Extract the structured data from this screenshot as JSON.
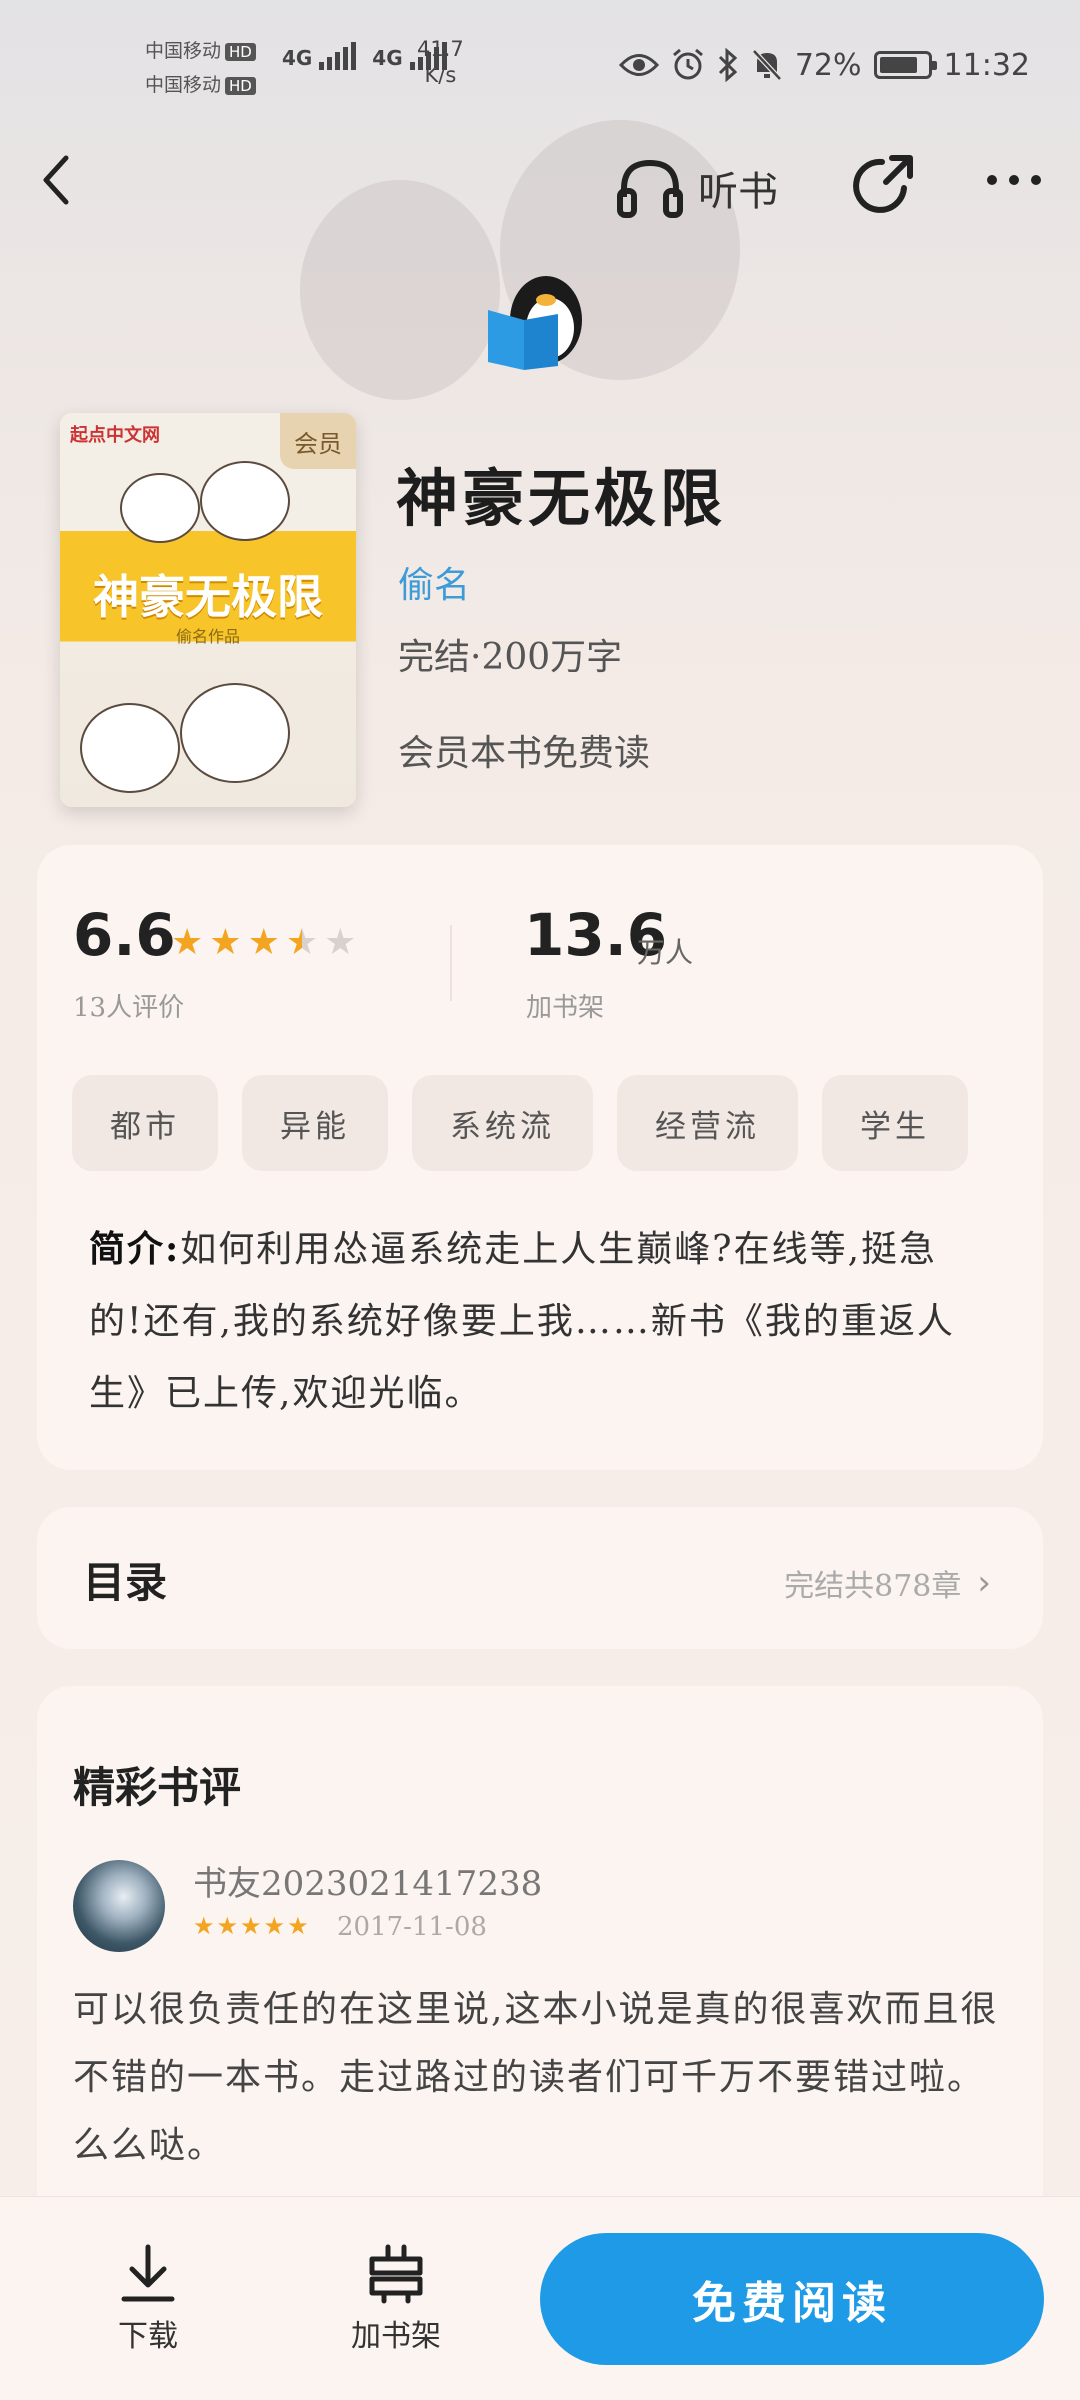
{
  "status_bar": {
    "carrier_1": "中国移动",
    "carrier_2": "中国移动",
    "hd": "HD",
    "net_1": "4G",
    "net_2": "4G",
    "speed_value": "41.7",
    "speed_unit": "K/s",
    "battery": "72%",
    "time": "11:32"
  },
  "nav": {
    "listen_label": "听书"
  },
  "book": {
    "cover_brand": "起点中文网",
    "cover_vip": "会员",
    "cover_title": "神豪无极限",
    "cover_author": "偷名作品",
    "title": "神豪无极限",
    "author": "偷名",
    "meta": "完结·200万字",
    "vip_note": "会员本书免费读"
  },
  "stats": {
    "rating": "6.6",
    "rating_stars": 3.5,
    "rating_count": "13人评价",
    "shelf_num": "13.6",
    "shelf_unit": "万人",
    "shelf_label": "加书架"
  },
  "tags": [
    "都市",
    "异能",
    "系统流",
    "经营流",
    "学生"
  ],
  "intro": {
    "label": "简介:",
    "text": "如何利用怂逼系统走上人生巅峰?在线等,挺急的!还有,我的系统好像要上我……新书《我的重返人生》已上传,欢迎光临。"
  },
  "toc": {
    "title": "目录",
    "info": "完结共878章"
  },
  "review": {
    "section_title": "精彩书评",
    "user": "书友2023021417238",
    "stars": 5,
    "date": "2017-11-08",
    "text": "可以很负责任的在这里说,这本小说是真的很喜欢而且很不错的一本书。走过路过的读者们可千万不要错过啦。么么哒。"
  },
  "bottom": {
    "download": "下载",
    "add_shelf": "加书架",
    "read": "免费阅读"
  },
  "colors": {
    "accent": "#1f9ae6",
    "author_link": "#3d9bd7",
    "star": "#f3a521"
  }
}
